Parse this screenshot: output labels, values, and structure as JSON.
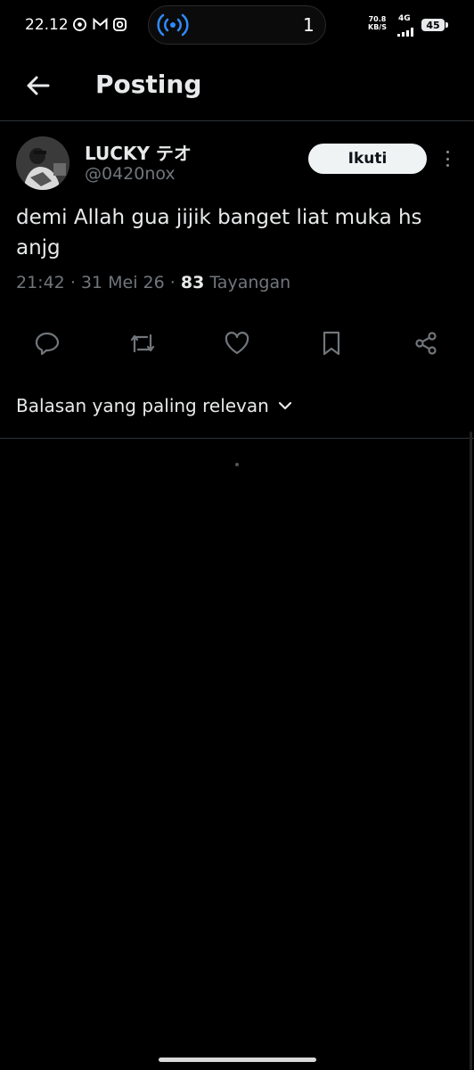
{
  "status_bar": {
    "time": "22.12",
    "icons": [
      "github-icon",
      "gmail-icon",
      "instagram-icon"
    ],
    "broadcast_count": "1",
    "net_speed_value": "70.8",
    "net_speed_unit": "KB/S",
    "network_type": "4G",
    "battery": "45"
  },
  "header": {
    "title": "Posting"
  },
  "post": {
    "author_name": "LUCKY テオ",
    "author_handle": "@0420nox",
    "follow_label": "Ikuti",
    "text": "demi Allah gua jijik banget liat muka hs anjg",
    "time": "21:42",
    "date": "31 Mei 26",
    "views": "83",
    "views_label": "Tayangan"
  },
  "actions": [
    "reply-icon",
    "repost-icon",
    "like-icon",
    "bookmark-icon",
    "share-icon"
  ],
  "replies": {
    "sort_label": "Balasan yang paling relevan"
  },
  "colors": {
    "background": "#000000",
    "text": "#e7e9ea",
    "secondary": "#71767b",
    "accent": "#1d9bf0",
    "divider": "#2f3336"
  }
}
